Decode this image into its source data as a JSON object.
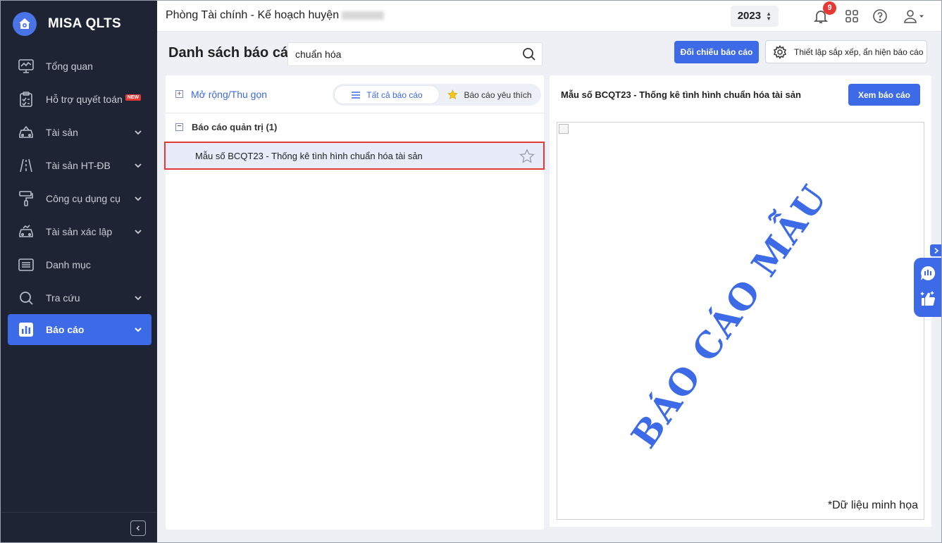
{
  "app": {
    "name": "MISA QLTS"
  },
  "sidebar": {
    "items": [
      {
        "label": "Tổng quan",
        "icon": "monitor-chart-icon",
        "has_children": false
      },
      {
        "label": "Hỗ trợ quyết toán",
        "icon": "clipboard-check-icon",
        "badge": "NEW",
        "has_children": false
      },
      {
        "label": "Tài sản",
        "icon": "car-icon",
        "has_children": true
      },
      {
        "label": "Tài sản HT-ĐB",
        "icon": "road-icon",
        "has_children": true
      },
      {
        "label": "Công cụ dụng cụ",
        "icon": "paint-roller-icon",
        "has_children": true
      },
      {
        "label": "Tài sản xác lập",
        "icon": "car-check-icon",
        "has_children": true
      },
      {
        "label": "Danh mục",
        "icon": "list-icon",
        "has_children": false
      },
      {
        "label": "Tra cứu",
        "icon": "search-icon",
        "has_children": true
      },
      {
        "label": "Báo cáo",
        "icon": "bar-chart-icon",
        "has_children": true,
        "active": true
      }
    ]
  },
  "header": {
    "org_title": "Phòng Tài chính - Kế hoạch huyện",
    "year": "2023",
    "notification_count": "9"
  },
  "page": {
    "title": "Danh sách báo cáo",
    "search": {
      "value": "chuẩn hóa",
      "placeholder": ""
    },
    "compare_button": "Đối chiếu báo cáo",
    "settings_button": "Thiết lập sắp xếp, ẩn hiện báo cáo"
  },
  "left_panel": {
    "expand_label": "Mở rộng/Thu gọn",
    "tabs": [
      {
        "label": "Tất cả báo cáo",
        "icon": "list-lines-icon",
        "active": true
      },
      {
        "label": "Báo cáo yêu thích",
        "icon": "star-icon",
        "active": false
      }
    ],
    "group": {
      "label": "Báo cáo quản trị (1)"
    },
    "reports": [
      {
        "label": "Mẫu số BCQT23 - Thống kê tình hình chuẩn hóa tài sản",
        "favorite": false,
        "selected": true
      }
    ]
  },
  "right_panel": {
    "title": "Mẫu số BCQT23 - Thống kê tình hình chuẩn hóa tài sản",
    "view_button": "Xem báo cáo",
    "watermark": "BÁO CÁO MẪU",
    "note": "*Dữ liệu minh họa"
  },
  "colors": {
    "accent": "#3d6ae6",
    "sidebar_bg": "#1e2433",
    "highlight_border": "#e53935",
    "badge": "#e53935"
  }
}
